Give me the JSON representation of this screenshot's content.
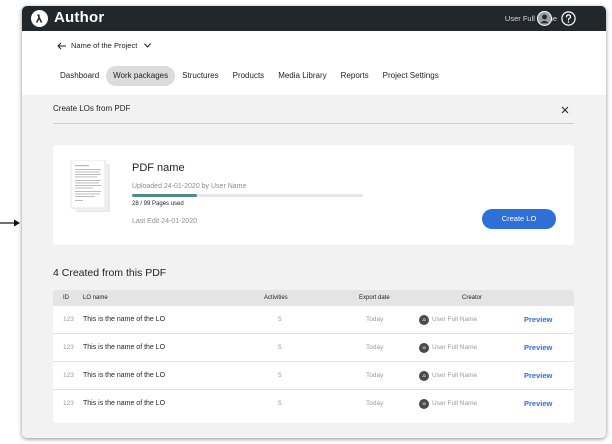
{
  "app": {
    "title": "Author",
    "user_name": "User Full Name"
  },
  "project": {
    "name": "Name of the Project"
  },
  "nav": {
    "tabs": [
      {
        "label": "Dashboard",
        "active": false
      },
      {
        "label": "Work packages",
        "active": true
      },
      {
        "label": "Structures",
        "active": false
      },
      {
        "label": "Products",
        "active": false
      },
      {
        "label": "Media Library",
        "active": false
      },
      {
        "label": "Reports",
        "active": false
      },
      {
        "label": "Project Settings",
        "active": false
      }
    ]
  },
  "panel": {
    "title": "Create LOs from PDF"
  },
  "pdf": {
    "name": "PDF name",
    "uploaded": "Uploaded 24-01-2020 by User Name",
    "pages_used": "28 / 99 Pages used",
    "pages_progress": 0.283,
    "last_edit": "Last Edit 24-01-2020",
    "create_button": "Create LO"
  },
  "created": {
    "title": "4 Created from this PDF",
    "columns": {
      "id": "ID",
      "name": "LO name",
      "activities": "Activities",
      "export": "Export date",
      "creator": "Creator"
    },
    "rows": [
      {
        "id": "123",
        "name": "This is the name of the LO",
        "activities": "5",
        "export": "Today",
        "avatar": "JD",
        "creator": "User Full Name",
        "action": "Preview"
      },
      {
        "id": "123",
        "name": "This is the name of the LO",
        "activities": "5",
        "export": "Today",
        "avatar": "JD",
        "creator": "User Full Name",
        "action": "Preview"
      },
      {
        "id": "123",
        "name": "This is the name of the LO",
        "activities": "5",
        "export": "Today",
        "avatar": "JD",
        "creator": "User Full Name",
        "action": "Preview"
      },
      {
        "id": "123",
        "name": "This is the name of the LO",
        "activities": "5",
        "export": "Today",
        "avatar": "JD",
        "creator": "User Full Name",
        "action": "Preview"
      }
    ]
  },
  "colors": {
    "topbar": "#22272c",
    "accent": "#2f6fd8",
    "progress": "#4c8a8e",
    "content_bg": "#f2f2f2"
  }
}
